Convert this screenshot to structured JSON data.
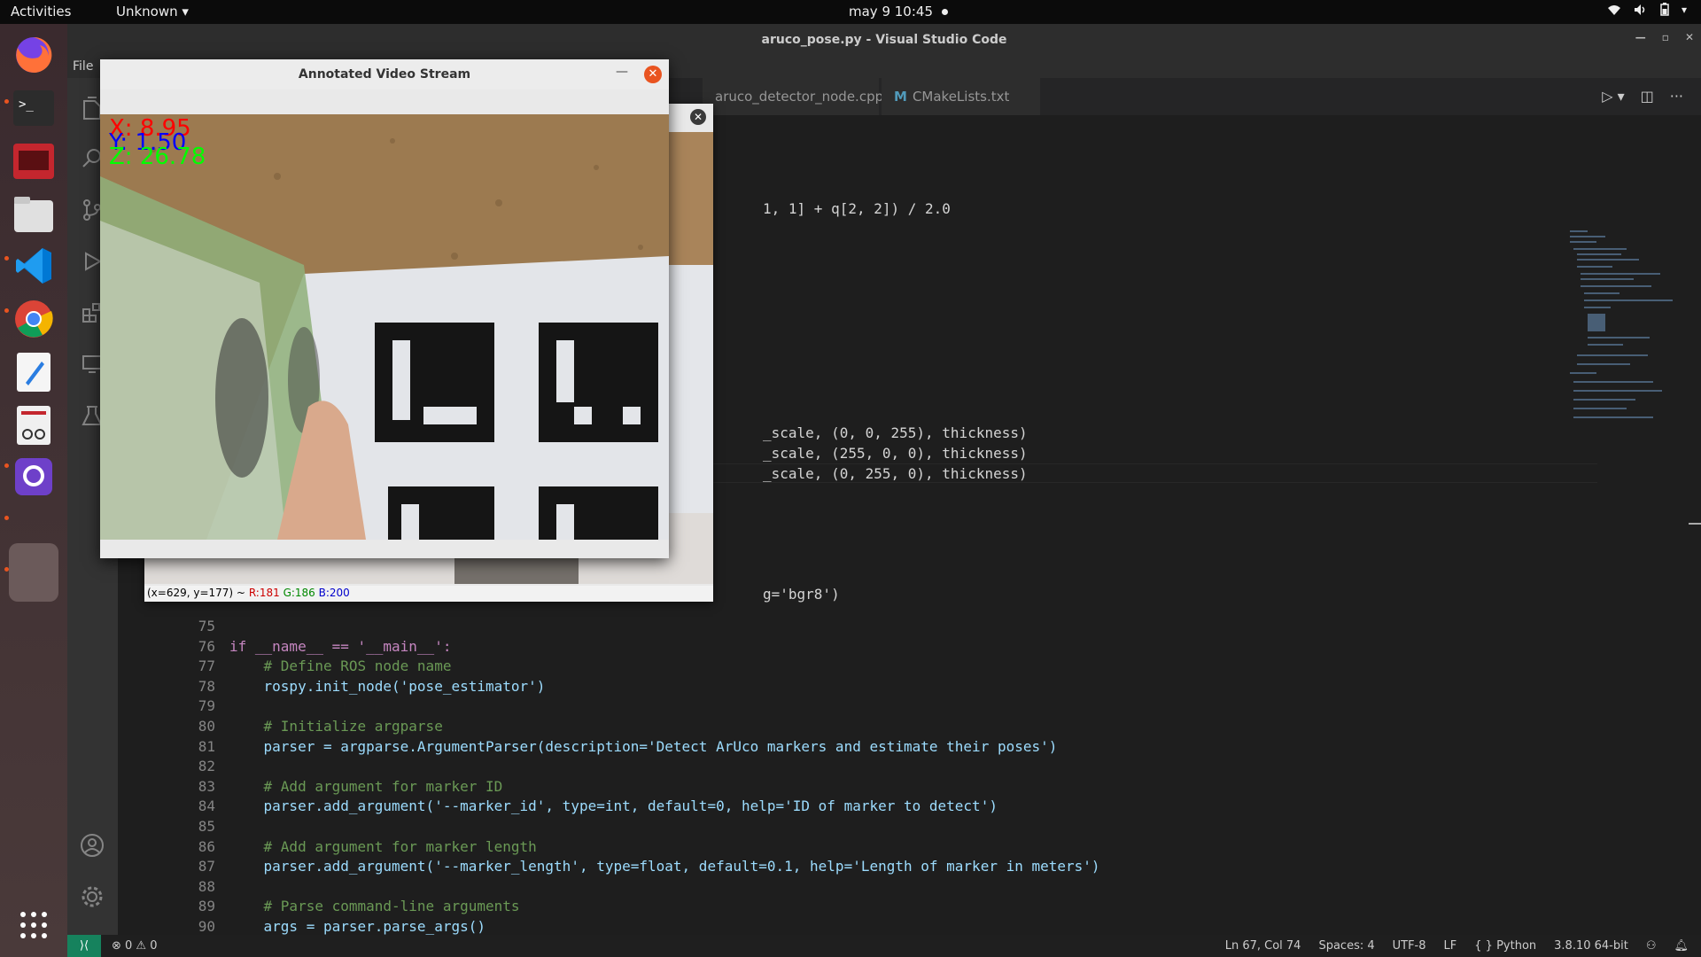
{
  "topbar": {
    "activities": "Activities",
    "app_menu": "Unknown",
    "clock": "may 9  10:45"
  },
  "vscode": {
    "window_title": "aruco_pose.py - Visual Studio Code",
    "menu": {
      "file": "File"
    },
    "tabs": [
      {
        "label": "aruco_detector_node.cpp"
      },
      {
        "label": "CMakeLists.txt",
        "icon": "M"
      }
    ],
    "code_top": [
      {
        "text": "1, 1] + q[2, 2]) / 2.0"
      },
      {
        "text": "_scale, (0, 0, 255), thickness)"
      },
      {
        "text": "_scale, (255, 0, 0), thickness)"
      },
      {
        "text": "_scale, (0, 255, 0), thickness)"
      },
      {
        "text": "g='bgr8')"
      }
    ],
    "lines": [
      {
        "n": "75",
        "text": ""
      },
      {
        "n": "76",
        "text": "if __name__ == '__main__':"
      },
      {
        "n": "77",
        "text": "    # Define ROS node name"
      },
      {
        "n": "78",
        "text": "    rospy.init_node('pose_estimator')"
      },
      {
        "n": "79",
        "text": ""
      },
      {
        "n": "80",
        "text": "    # Initialize argparse"
      },
      {
        "n": "81",
        "text": "    parser = argparse.ArgumentParser(description='Detect ArUco markers and estimate their poses')"
      },
      {
        "n": "82",
        "text": ""
      },
      {
        "n": "83",
        "text": "    # Add argument for marker ID"
      },
      {
        "n": "84",
        "text": "    parser.add_argument('--marker_id', type=int, default=0, help='ID of marker to detect')"
      },
      {
        "n": "85",
        "text": ""
      },
      {
        "n": "86",
        "text": "    # Add argument for marker length"
      },
      {
        "n": "87",
        "text": "    parser.add_argument('--marker_length', type=float, default=0.1, help='Length of marker in meters')"
      },
      {
        "n": "88",
        "text": ""
      },
      {
        "n": "89",
        "text": "    # Parse command-line arguments"
      },
      {
        "n": "90",
        "text": "    args = parser.parse_args()"
      }
    ],
    "status": {
      "problems": "⊗ 0 ⚠ 0",
      "position": "Ln 67, Col 74",
      "spaces": "Spaces: 4",
      "encoding": "UTF-8",
      "eol": "LF",
      "language": "{ } Python",
      "interpreter": "3.8.10 64-bit"
    }
  },
  "front_window": {
    "title": "Annotated Video Stream",
    "overlay": {
      "x": "X: 8.95",
      "y": "Y: 1.50",
      "z": "Z: 26.78"
    },
    "overlay_colors": {
      "x": "#ff0000",
      "y": "#0000ff",
      "z": "#00ff00"
    }
  },
  "back_window": {
    "status_coords": "(x=629, y=177) ~",
    "status_r": "R:181",
    "status_g": "G:186",
    "status_b": "B:200"
  }
}
